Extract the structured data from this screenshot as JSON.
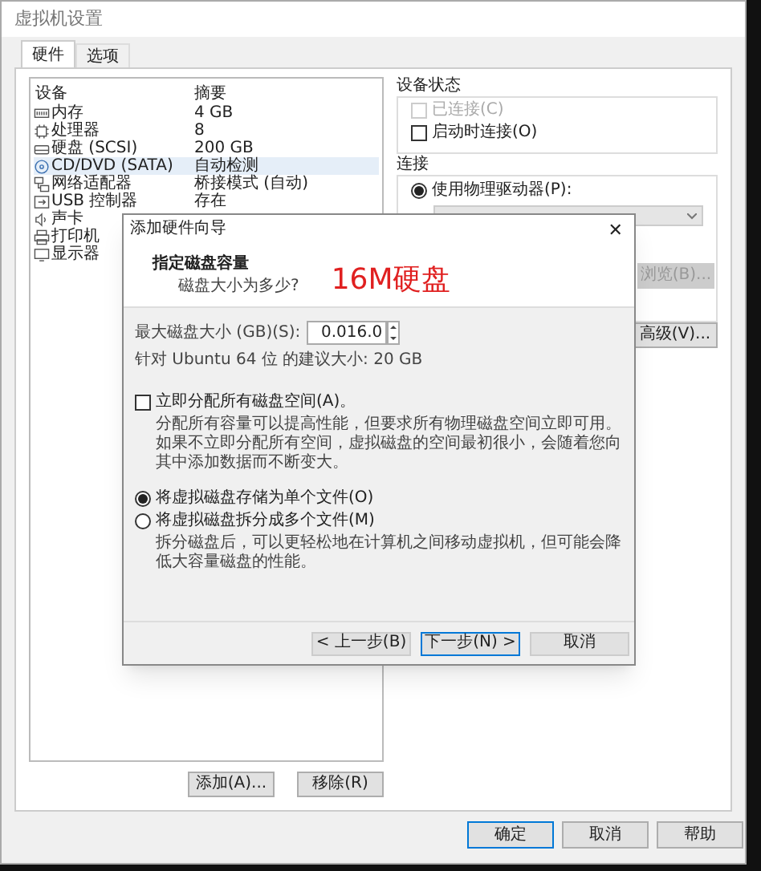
{
  "window": {
    "title": "虚拟机设置"
  },
  "tabs": [
    {
      "label": "硬件",
      "selected": true
    },
    {
      "label": "选项",
      "selected": false
    }
  ],
  "device_list": {
    "columns": [
      "设备",
      "摘要"
    ],
    "rows": [
      {
        "kind": "memory",
        "device": "内存",
        "summary": "4 GB",
        "selected": false
      },
      {
        "kind": "cpu",
        "device": "处理器",
        "summary": "8",
        "selected": false
      },
      {
        "kind": "disk",
        "device": "硬盘 (SCSI)",
        "summary": "200 GB",
        "selected": false
      },
      {
        "kind": "cd",
        "device": "CD/DVD (SATA)",
        "summary": "自动检测",
        "selected": true
      },
      {
        "kind": "network",
        "device": "网络适配器",
        "summary": "桥接模式 (自动)",
        "selected": false
      },
      {
        "kind": "usb",
        "device": "USB 控制器",
        "summary": "存在",
        "selected": false
      },
      {
        "kind": "sound",
        "device": "声卡",
        "selected": false
      },
      {
        "kind": "printer",
        "device": "打印机",
        "selected": false
      },
      {
        "kind": "display",
        "device": "显示器",
        "selected": false
      }
    ]
  },
  "list_buttons": [
    "添加(A)...",
    "移除(R)"
  ],
  "device_status": {
    "title": "设备状态",
    "options": [
      {
        "label": "已连接(C)",
        "checked": false,
        "disabled": true
      },
      {
        "label": "启动时连接(O)",
        "checked": false,
        "disabled": false
      }
    ]
  },
  "connection": {
    "title": "连接",
    "options": [
      {
        "label": "使用物理驱动器(P):",
        "selected": true
      }
    ],
    "browse_button": {
      "label": "浏览(B)...",
      "disabled": true
    }
  },
  "advanced_button": "高级(V)...",
  "footer_buttons": [
    {
      "label": "确定",
      "default": true
    },
    {
      "label": "取消",
      "default": false
    },
    {
      "label": "帮助",
      "default": false
    }
  ],
  "dialog": {
    "title": "添加硬件向导",
    "close": "✕",
    "heading": "指定磁盘容量",
    "subheading": "磁盘大小为多少?",
    "annotation": "16M硬盘",
    "size_label": "最大磁盘大小 (GB)(S):",
    "size_value": "0.016.0",
    "recommendation": "针对 Ubuntu 64 位 的建议大小: 20 GB",
    "allocate": {
      "label": "立即分配所有磁盘空间(A)。",
      "checked": false,
      "description": "分配所有容量可以提高性能，但要求所有物理磁盘空间立即可用。如果不立即分配所有空间，虚拟磁盘的空间最初很小，会随着您向其中添加数据而不断变大。"
    },
    "storage_options": [
      {
        "label": "将虚拟磁盘存储为单个文件(O)",
        "selected": true
      },
      {
        "label": "将虚拟磁盘拆分成多个文件(M)",
        "selected": false
      }
    ],
    "split_description": "拆分磁盘后，可以更轻松地在计算机之间移动虚拟机，但可能会降低大容量磁盘的性能。",
    "buttons": [
      {
        "label": "< 上一步(B)",
        "default": false
      },
      {
        "label": "下一步(N) >",
        "default": true
      },
      {
        "label": "取消",
        "default": false
      }
    ]
  }
}
